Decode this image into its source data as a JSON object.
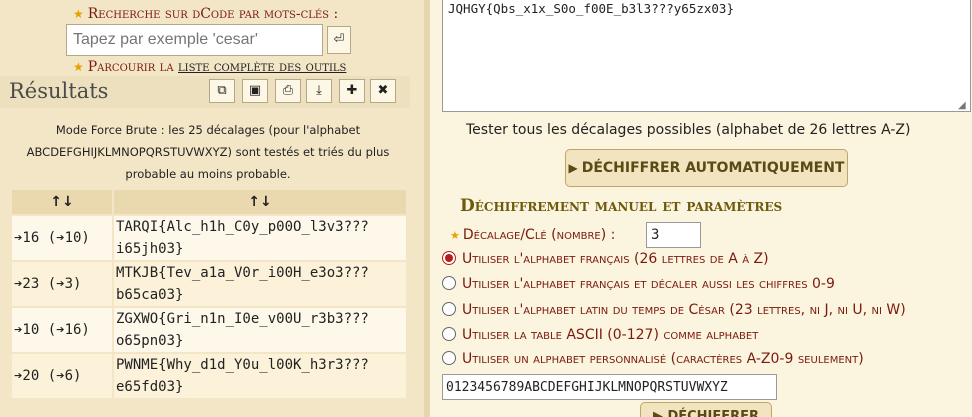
{
  "search": {
    "title": "Recherche sur dCode par mots-clés :",
    "placeholder": "Tapez par exemple 'cesar'",
    "go_icon": "enter-icon",
    "browse_prefix": "Parcourir la",
    "browse_link": "liste complète des outils"
  },
  "results": {
    "title": "Résultats",
    "toolbar_icons": [
      "copy-icon",
      "save-icon",
      "print-icon",
      "download-icon",
      "pin-icon",
      "close-icon"
    ],
    "note": "Mode Force Brute : les 25 décalages (pour l'alphabet ABCDEFGHIJKLMNOPQRSTUVWXYZ) sont testés et triés du plus probable au moins probable.",
    "col_headers": [
      "↑↓",
      "↑↓"
    ],
    "rows": [
      {
        "shift": "➔16 (➔10)",
        "text_line1": "TARQI{Alc_h1h_C0y_p00O_l3v3???",
        "text_line2": "i65jh03}"
      },
      {
        "shift": "➔23 (➔3)",
        "text_line1": "MTKJB{Tev_a1a_V0r_i00H_e3o3???",
        "text_line2": "b65ca03}"
      },
      {
        "shift": "➔10 (➔16)",
        "text_line1": "ZGXWO{Gri_n1n_I0e_v00U_r3b3???",
        "text_line2": "o65pn03}"
      },
      {
        "shift": "➔20 (➔6)",
        "text_line1": "PWNME{Why_d1d_Y0u_l00K_h3r3???",
        "text_line2": "e65fd03}"
      }
    ]
  },
  "cipher": {
    "text": "JQHGY{Qbs_x1x_S0o_f00E_b3l3???y65zx03}"
  },
  "test_all_label": "Tester tous les décalages possibles (alphabet de 26 lettres A-Z)",
  "auto_button": "DÉCHIFFRER AUTOMATIQUEMENT",
  "manual": {
    "title": "Déchiffrement manuel et paramètres",
    "shift_label": "Décalage/Clé (nombre) :",
    "shift_value": "3",
    "options": [
      {
        "label": "Utiliser l'alphabet français (26 lettres de A à Z)",
        "selected": true
      },
      {
        "label": "Utiliser l'alphabet français et décaler aussi les chiffres 0-9",
        "selected": false
      },
      {
        "label": "Utiliser l'alphabet latin du temps de César (23 lettres, ni J, ni U, ni W)",
        "selected": false
      },
      {
        "label": "Utiliser la table ASCII (0-127) comme alphabet",
        "selected": false
      },
      {
        "label": "Utiliser un alphabet personnalisé (caractères A-Z0-9 seulement)",
        "selected": false
      }
    ],
    "custom_alphabet": "0123456789ABCDEFGHIJKLMNOPQRSTUVWXYZ",
    "decrypt_button": "DÉCHIFFRER"
  },
  "colors": {
    "accent_red": "#7a1a0e",
    "title_gold": "#6e5a0c",
    "panel_bg": "#f3e6c7"
  }
}
